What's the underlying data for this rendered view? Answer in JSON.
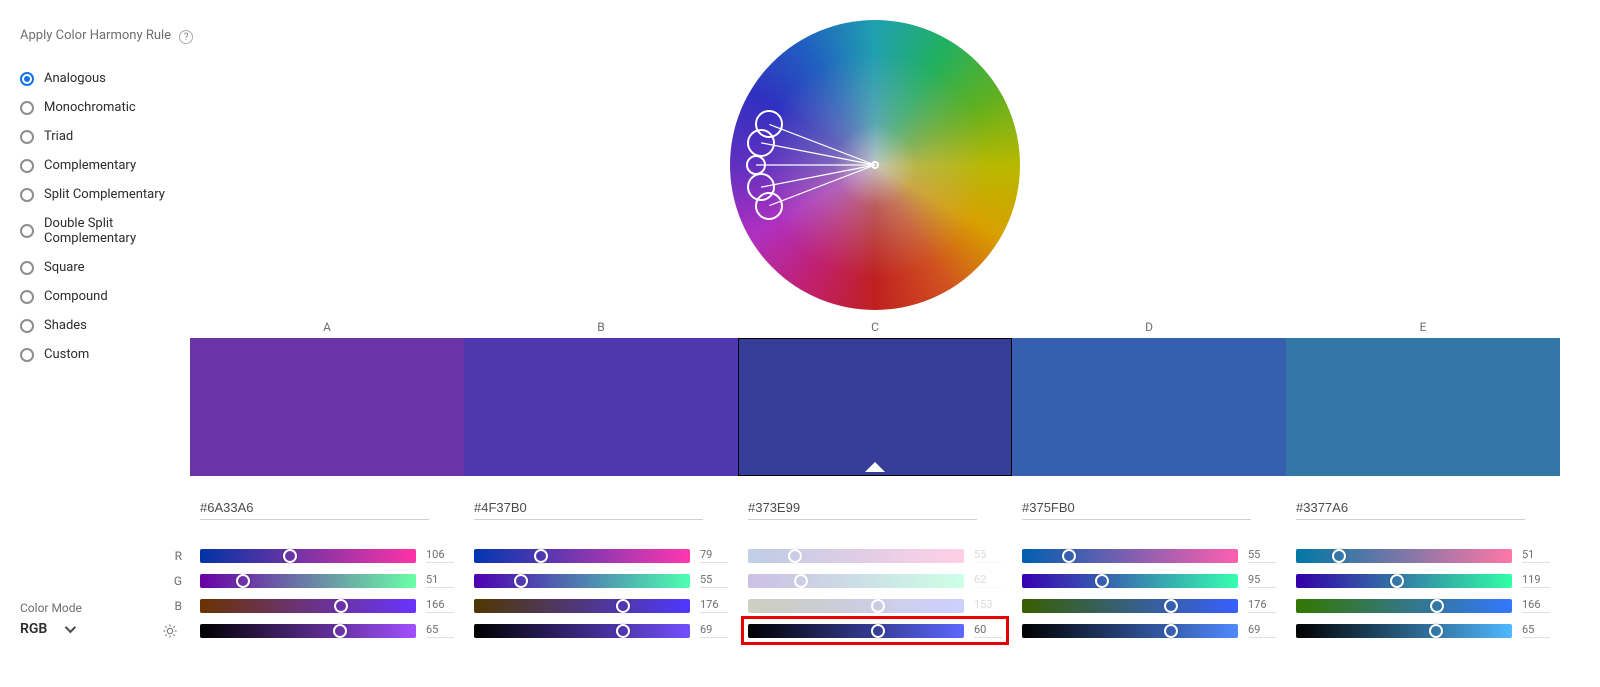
{
  "sidebar": {
    "title": "Apply Color Harmony Rule",
    "help": "?",
    "rules": [
      {
        "label": "Analogous",
        "selected": true
      },
      {
        "label": "Monochromatic",
        "selected": false
      },
      {
        "label": "Triad",
        "selected": false
      },
      {
        "label": "Complementary",
        "selected": false
      },
      {
        "label": "Split Complementary",
        "selected": false
      },
      {
        "label": "Double Split Complementary",
        "selected": false
      },
      {
        "label": "Square",
        "selected": false
      },
      {
        "label": "Compound",
        "selected": false
      },
      {
        "label": "Shades",
        "selected": false
      },
      {
        "label": "Custom",
        "selected": false
      }
    ]
  },
  "color_mode": {
    "label": "Color Mode",
    "value": "RGB"
  },
  "channels": {
    "r": "R",
    "g": "G",
    "b": "B"
  },
  "swatches": [
    {
      "label": "A",
      "hex": "#6A33A6",
      "r": 106,
      "g": 51,
      "b": 166,
      "bright": 65,
      "active": false,
      "grads": {
        "r": [
          "#0033A6",
          "#FF33A6"
        ],
        "g": [
          "#6A00A6",
          "#6AFFA6"
        ],
        "b": [
          "#6A3300",
          "#6A33FF"
        ],
        "l": [
          "#000000",
          "#A24FFF"
        ]
      }
    },
    {
      "label": "B",
      "hex": "#4F37B0",
      "r": 79,
      "g": 55,
      "b": 176,
      "bright": 69,
      "active": false,
      "grads": {
        "r": [
          "#0037B0",
          "#FF37B0"
        ],
        "g": [
          "#4F00B0",
          "#4FFFB0"
        ],
        "b": [
          "#4F3700",
          "#4F37FF"
        ],
        "l": [
          "#000000",
          "#7350FF"
        ]
      }
    },
    {
      "label": "C",
      "hex": "#373E99",
      "r": 55,
      "g": 62,
      "b": 153,
      "bright": 60,
      "active": true,
      "grads": {
        "r": [
          "#003E99",
          "#FF3E99"
        ],
        "g": [
          "#370099",
          "#37FF99"
        ],
        "b": [
          "#373E00",
          "#373EFF"
        ],
        "l": [
          "#000000",
          "#5C68FF"
        ]
      }
    },
    {
      "label": "D",
      "hex": "#375FB0",
      "r": 55,
      "g": 95,
      "b": 176,
      "bright": 69,
      "active": false,
      "grads": {
        "r": [
          "#005FB0",
          "#FF5FB0"
        ],
        "g": [
          "#3700B0",
          "#37FFB0"
        ],
        "b": [
          "#375F00",
          "#375FFF"
        ],
        "l": [
          "#000000",
          "#508AFF"
        ]
      }
    },
    {
      "label": "E",
      "hex": "#3377A6",
      "r": 51,
      "g": 119,
      "b": 166,
      "bright": 65,
      "active": false,
      "grads": {
        "r": [
          "#0077A6",
          "#FF77A6"
        ],
        "g": [
          "#3300A6",
          "#33FFA6"
        ],
        "b": [
          "#337700",
          "#3377FF"
        ],
        "l": [
          "#000000",
          "#4FB8FF"
        ]
      }
    }
  ],
  "wheel_handles": [
    {
      "angle": 69,
      "radius": 0.78
    },
    {
      "angle": 79,
      "radius": 0.8
    },
    {
      "angle": 90,
      "radius": 0.82,
      "base": true
    },
    {
      "angle": 101,
      "radius": 0.8
    },
    {
      "angle": 111,
      "radius": 0.78
    }
  ],
  "brightness_icon": "☀"
}
